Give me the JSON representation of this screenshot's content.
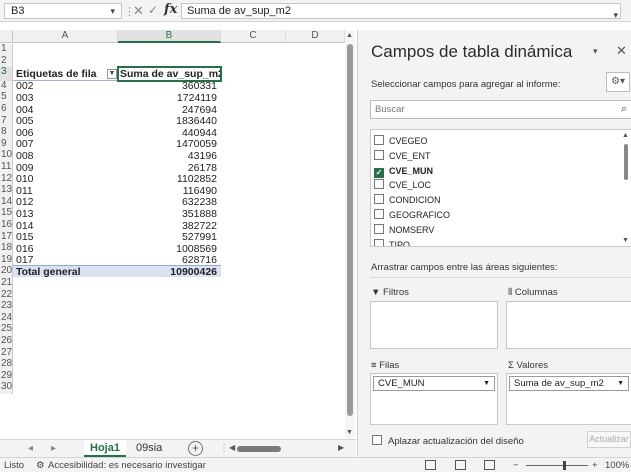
{
  "formula_bar": {
    "name_box": "B3",
    "formula": "Suma de av_sup_m2"
  },
  "columns": [
    "A",
    "B",
    "C",
    "D"
  ],
  "rows": [
    "1",
    "2",
    "3",
    "4",
    "5",
    "6",
    "7",
    "8",
    "9",
    "10",
    "11",
    "12",
    "13",
    "14",
    "15",
    "16",
    "17",
    "18",
    "19",
    "20",
    "21",
    "22",
    "23",
    "24",
    "25",
    "26",
    "27",
    "28",
    "29",
    "30"
  ],
  "pivot": {
    "row_label_header": "Etiquetas de fila",
    "value_header": "Suma de av_sup_m2",
    "items": [
      {
        "label": "002",
        "value": "360331"
      },
      {
        "label": "003",
        "value": "1724119"
      },
      {
        "label": "004",
        "value": "247694"
      },
      {
        "label": "005",
        "value": "1836440"
      },
      {
        "label": "006",
        "value": "440944"
      },
      {
        "label": "007",
        "value": "1470059"
      },
      {
        "label": "008",
        "value": "43196"
      },
      {
        "label": "009",
        "value": "26178"
      },
      {
        "label": "010",
        "value": "1102852"
      },
      {
        "label": "011",
        "value": "116490"
      },
      {
        "label": "012",
        "value": "632238"
      },
      {
        "label": "013",
        "value": "351888"
      },
      {
        "label": "014",
        "value": "382722"
      },
      {
        "label": "015",
        "value": "527991"
      },
      {
        "label": "016",
        "value": "1008569"
      },
      {
        "label": "017",
        "value": "628716"
      }
    ],
    "total_label": "Total general",
    "total_value": "10900426"
  },
  "sheet_tabs": {
    "active": "Hoja1",
    "other": "09sia",
    "add": "+"
  },
  "status_bar": {
    "ready": "Listo",
    "accessibility": "Accesibilidad: es necesario investigar",
    "zoom": "100%",
    "zoom_minus": "−",
    "zoom_plus": "+"
  },
  "pivot_panel": {
    "title": "Campos de tabla dinámica",
    "subtitle": "Seleccionar campos para agregar al informe:",
    "search_placeholder": "Buscar",
    "fields": [
      {
        "name": "CVEGEO",
        "checked": false
      },
      {
        "name": "CVE_ENT",
        "checked": false
      },
      {
        "name": "CVE_MUN",
        "checked": true
      },
      {
        "name": "CVE_LOC",
        "checked": false
      },
      {
        "name": "CONDICION",
        "checked": false
      },
      {
        "name": "GEOGRAFICO",
        "checked": false
      },
      {
        "name": "NOMSERV",
        "checked": false
      },
      {
        "name": "TIPO",
        "checked": false
      }
    ],
    "drag_label": "Arrastrar campos entre las áreas siguientes:",
    "filters_label": "Filtros",
    "columns_label": "Columnas",
    "rows_label": "Filas",
    "values_label": "Valores",
    "rows_field": "CVE_MUN",
    "values_field": "Suma de av_sup_m2",
    "defer_label": "Aplazar actualización del diseño",
    "update_button": "Actualizar"
  }
}
